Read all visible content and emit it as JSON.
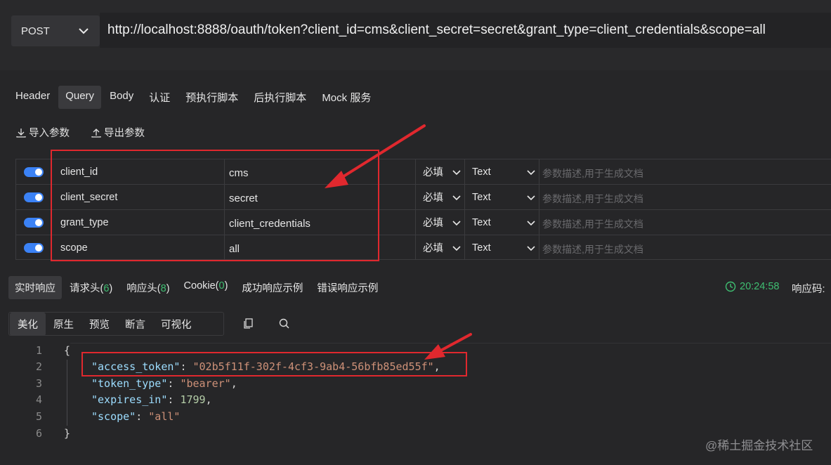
{
  "request": {
    "method": "POST",
    "url": "http://localhost:8888/oauth/token?client_id=cms&client_secret=secret&grant_type=client_credentials&scope=all"
  },
  "tabs": [
    "Header",
    "Query",
    "Body",
    "认证",
    "预执行脚本",
    "后执行脚本",
    "Mock 服务"
  ],
  "active_tab": "Query",
  "tools": {
    "import": "导入参数",
    "export": "导出参数"
  },
  "params": [
    {
      "enabled": true,
      "key": "client_id",
      "value": "cms",
      "required": "必填",
      "type": "Text",
      "desc_placeholder": "参数描述,用于生成文档"
    },
    {
      "enabled": true,
      "key": "client_secret",
      "value": "secret",
      "required": "必填",
      "type": "Text",
      "desc_placeholder": "参数描述,用于生成文档"
    },
    {
      "enabled": true,
      "key": "grant_type",
      "value": "client_credentials",
      "required": "必填",
      "type": "Text",
      "desc_placeholder": "参数描述,用于生成文档"
    },
    {
      "enabled": true,
      "key": "scope",
      "value": "all",
      "required": "必填",
      "type": "Text",
      "desc_placeholder": "参数描述,用于生成文档"
    }
  ],
  "response_tabs": {
    "realtime": "实时响应",
    "req_headers": "请求头(",
    "req_headers_count": "6",
    "resp_headers": "响应头(",
    "resp_headers_count": "8",
    "cookie": "Cookie(",
    "cookie_count": "0",
    "close_paren": ")",
    "success_example": "成功响应示例",
    "error_example": "错误响应示例"
  },
  "response_time": "20:24:58",
  "response_code_label": "响应码:",
  "view_tabs": [
    "美化",
    "原生",
    "预览",
    "断言",
    "可视化"
  ],
  "active_view": "美化",
  "code_lines": [
    {
      "num": "1",
      "text": "{"
    },
    {
      "num": "2",
      "key": "\"access_token\"",
      "sep": ": ",
      "value": "\"02b5f11f-302f-4cf3-9ab4-56bfb85ed55f\"",
      "kind": "s",
      "end": ","
    },
    {
      "num": "3",
      "key": "\"token_type\"",
      "sep": ": ",
      "value": "\"bearer\"",
      "kind": "s",
      "end": ","
    },
    {
      "num": "4",
      "key": "\"expires_in\"",
      "sep": ": ",
      "value": "1799",
      "kind": "n",
      "end": ","
    },
    {
      "num": "5",
      "key": "\"scope\"",
      "sep": ": ",
      "value": "\"all\"",
      "kind": "s",
      "end": ""
    },
    {
      "num": "6",
      "text": "}"
    }
  ],
  "watermark": "@稀土掘金技术社区",
  "colors": {
    "accent": "#3b82f6",
    "highlight": "#e0282e",
    "success": "#3fbf72"
  }
}
